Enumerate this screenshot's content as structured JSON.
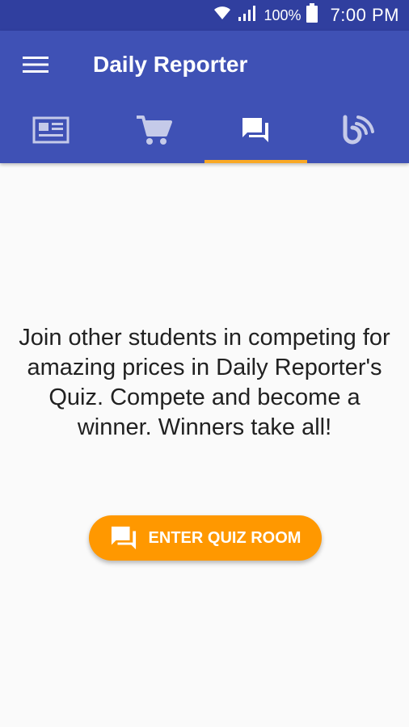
{
  "status_bar": {
    "battery_percent": "100%",
    "time": "7:00 PM",
    "icons": [
      "wifi-icon",
      "signal-icon",
      "battery-icon"
    ]
  },
  "app_bar": {
    "title": "Daily Reporter",
    "menu_icon": "menu-icon",
    "background": "#3f51b5",
    "status_background": "#303f9f"
  },
  "tabs": [
    {
      "icon": "newspaper-icon",
      "active": false
    },
    {
      "icon": "shopping-cart-icon",
      "active": false
    },
    {
      "icon": "forum-icon",
      "active": true
    },
    {
      "icon": "blog-icon",
      "active": false
    }
  ],
  "tab_indicator_color": "#f9a825",
  "main": {
    "message": "Join other students in competing for amazing prices in Daily Reporter's Quiz. Compete and become a winner. Winners take all!",
    "button_label": "ENTER QUIZ ROOM",
    "button_icon": "forum-icon",
    "button_color": "#ff9800"
  }
}
